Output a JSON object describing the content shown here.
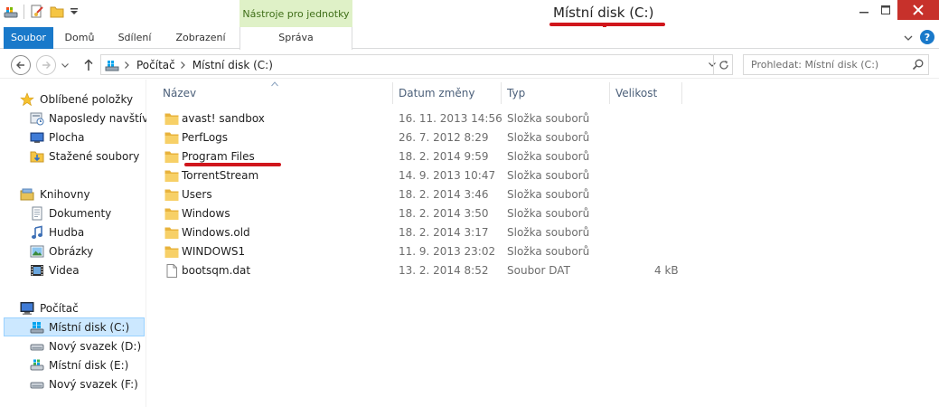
{
  "window": {
    "title": "Místní disk (C:)",
    "context_tab_group": "Nástroje pro jednotky"
  },
  "ribbon": {
    "tabs": [
      {
        "label": "Soubor",
        "active": true
      },
      {
        "label": "Domů"
      },
      {
        "label": "Sdílení"
      },
      {
        "label": "Zobrazení"
      },
      {
        "label": "Správa"
      }
    ],
    "help_label": "?"
  },
  "address_bar": {
    "breadcrumbs": [
      "Počítač",
      "Místní disk (C:)"
    ],
    "search_placeholder": "Prohledat: Místní disk (C:)"
  },
  "sidebar": {
    "favorites": {
      "label": "Oblíbené položky",
      "icon": "star-icon",
      "items": [
        {
          "label": "Naposledy navštívené",
          "icon": "recent-places-icon"
        },
        {
          "label": "Plocha",
          "icon": "desktop-icon"
        },
        {
          "label": "Stažené soubory",
          "icon": "downloads-icon"
        }
      ]
    },
    "libraries": {
      "label": "Knihovny",
      "icon": "library-icon",
      "items": [
        {
          "label": "Dokumenty",
          "icon": "documents-icon"
        },
        {
          "label": "Hudba",
          "icon": "music-icon"
        },
        {
          "label": "Obrázky",
          "icon": "pictures-icon"
        },
        {
          "label": "Videa",
          "icon": "videos-icon"
        }
      ]
    },
    "computer": {
      "label": "Počítač",
      "icon": "computer-icon",
      "items": [
        {
          "label": "Místní disk (C:)",
          "icon": "windows-drive-icon",
          "selected": true
        },
        {
          "label": "Nový svazek (D:)",
          "icon": "drive-icon"
        },
        {
          "label": "Místní disk (E:)",
          "icon": "drive-icon"
        },
        {
          "label": "Nový svazek (F:)",
          "icon": "drive-icon"
        }
      ]
    }
  },
  "file_list": {
    "columns": {
      "name": "Název",
      "date": "Datum změny",
      "type": "Typ",
      "size": "Velikost"
    },
    "rows": [
      {
        "name": "avast! sandbox",
        "date": "16. 11. 2013 14:56",
        "type": "Složka souborů",
        "size": "",
        "icon": "folder-icon"
      },
      {
        "name": "PerfLogs",
        "date": "26. 7. 2012 8:29",
        "type": "Složka souborů",
        "size": "",
        "icon": "folder-icon"
      },
      {
        "name": "Program Files",
        "date": "18. 2. 2014 9:59",
        "type": "Složka souborů",
        "size": "",
        "icon": "folder-icon"
      },
      {
        "name": "TorrentStream",
        "date": "14. 9. 2013 10:47",
        "type": "Složka souborů",
        "size": "",
        "icon": "folder-icon"
      },
      {
        "name": "Users",
        "date": "18. 2. 2014 3:46",
        "type": "Složka souborů",
        "size": "",
        "icon": "folder-icon"
      },
      {
        "name": "Windows",
        "date": "18. 2. 2014 3:50",
        "type": "Složka souborů",
        "size": "",
        "icon": "folder-icon"
      },
      {
        "name": "Windows.old",
        "date": "18. 2. 2014 3:17",
        "type": "Složka souborů",
        "size": "",
        "icon": "folder-icon"
      },
      {
        "name": "WINDOWS1",
        "date": "11. 9. 2013 23:02",
        "type": "Složka souborů",
        "size": "",
        "icon": "folder-icon"
      },
      {
        "name": "bootsqm.dat",
        "date": "13. 2. 2014 8:52",
        "type": "Soubor DAT",
        "size": "4 kB",
        "icon": "file-icon"
      }
    ]
  },
  "colors": {
    "accent": "#1979ca",
    "selection": "#cce8ff",
    "context_tab": "#dff1c7",
    "annotation": "#d0161c",
    "close_button": "#c7312b"
  }
}
